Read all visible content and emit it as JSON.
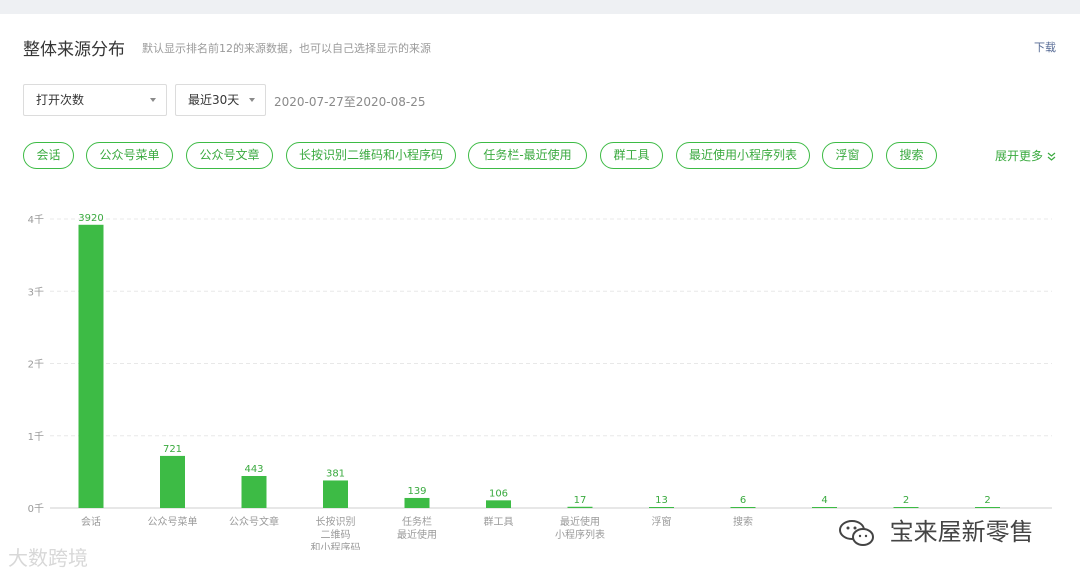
{
  "header": {
    "title": "整体来源分布",
    "subtitle": "默认显示排名前12的来源数据，也可以自己选择显示的来源",
    "download": "下载"
  },
  "filters": {
    "metric": "打开次数",
    "range": "最近30天",
    "date_range": "2020-07-27至2020-08-25"
  },
  "source_chips": [
    "会话",
    "公众号菜单",
    "公众号文章",
    "长按识别二维码和小程序码",
    "任务栏-最近使用",
    "群工具",
    "最近使用小程序列表",
    "浮窗",
    "搜索"
  ],
  "expand_more": "展开更多",
  "colors": {
    "accent": "#3dbb45",
    "bar": "#3dbb45",
    "grid": "#e8e8e8"
  },
  "chart_data": {
    "type": "bar",
    "title": "",
    "xlabel": "",
    "ylabel": "",
    "ylim": [
      0,
      4000
    ],
    "yticks": [
      {
        "value": 0,
        "label": "0千"
      },
      {
        "value": 1000,
        "label": "1千"
      },
      {
        "value": 2000,
        "label": "2千"
      },
      {
        "value": 3000,
        "label": "3千"
      },
      {
        "value": 4000,
        "label": "4千"
      }
    ],
    "categories": [
      [
        "会话"
      ],
      [
        "公众号菜单"
      ],
      [
        "公众号文章"
      ],
      [
        "长按识别",
        "二维码",
        "和小程序码"
      ],
      [
        "任务栏",
        "最近使用"
      ],
      [
        "群工具"
      ],
      [
        "最近使用",
        "小程序列表"
      ],
      [
        "浮窗"
      ],
      [
        "搜索"
      ],
      [
        ""
      ],
      [
        ""
      ],
      [
        ""
      ]
    ],
    "values": [
      3920,
      721,
      443,
      381,
      139,
      106,
      17,
      13,
      6,
      4,
      2,
      2
    ],
    "grid": true,
    "legend": "none"
  },
  "watermarks": {
    "left": "大数跨境",
    "right": "宝来屋新零售"
  }
}
